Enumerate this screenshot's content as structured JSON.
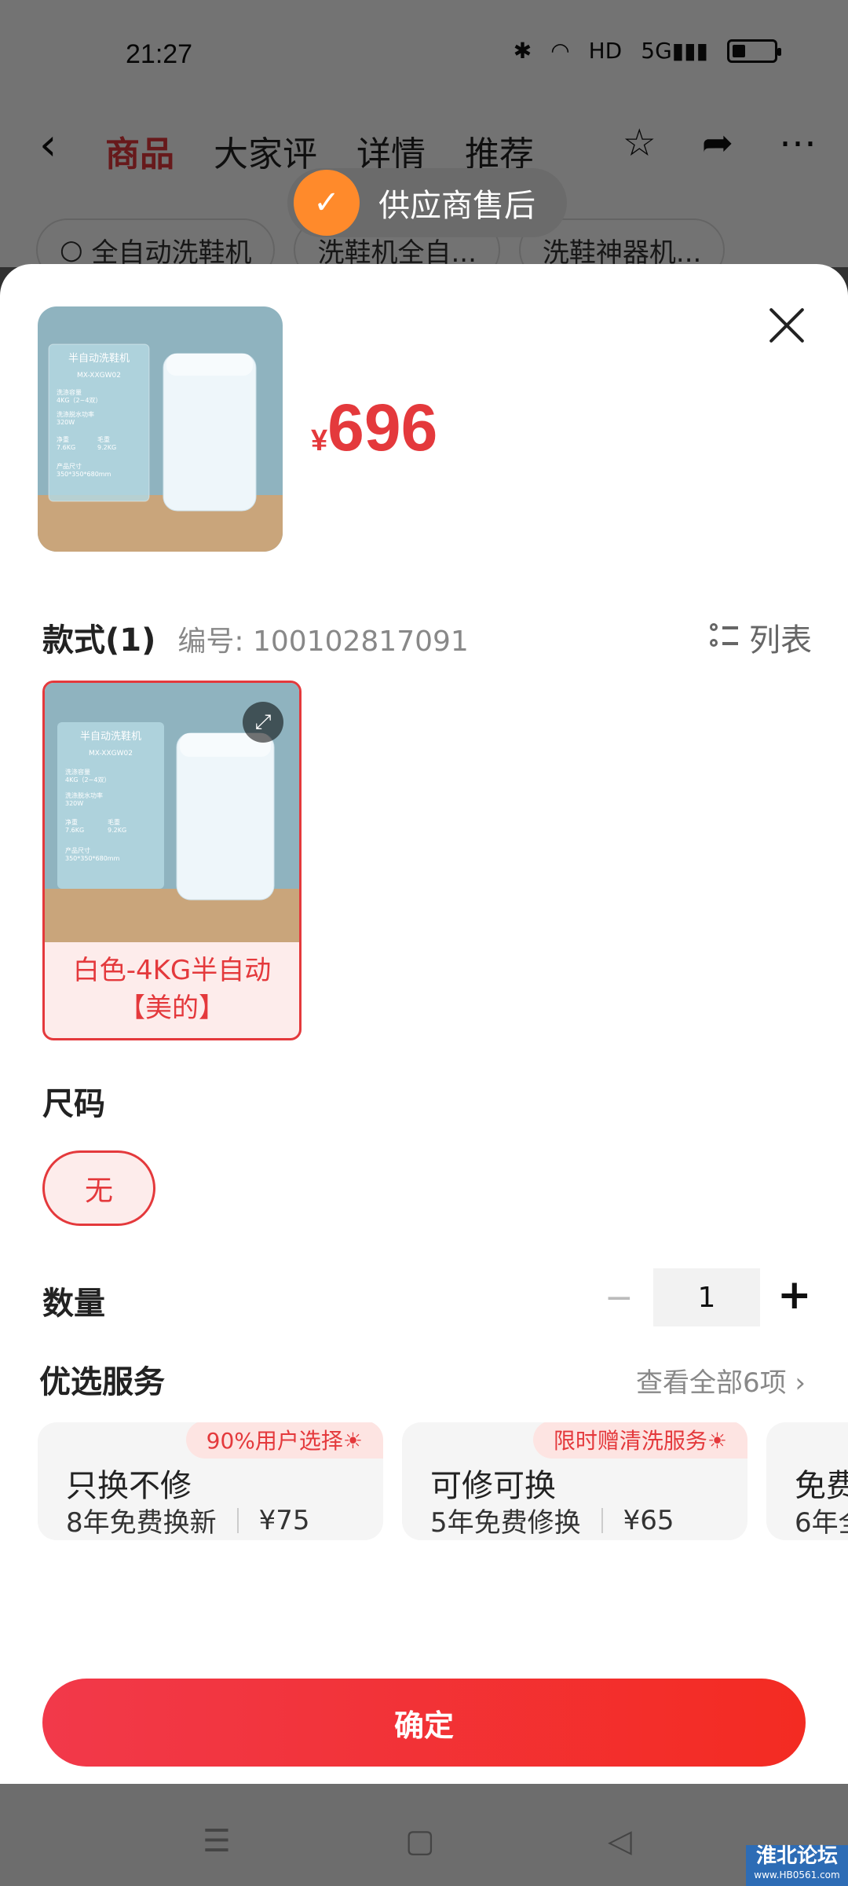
{
  "status_bar": {
    "time": "21:27",
    "bluetooth": "bluetooth-icon",
    "wifi": "wifi-icon",
    "hd": "HD",
    "network": "5G"
  },
  "nav": {
    "back_icon": "chevron-left-icon",
    "tabs": [
      "商品",
      "大家评",
      "详情",
      "推荐"
    ],
    "active_tab": "商品",
    "favorite_icon": "star-icon",
    "share_icon": "share-icon",
    "more_icon": "more-icon"
  },
  "toast": {
    "text": "供应商售后"
  },
  "search_chips": [
    "全自动洗鞋机",
    "洗鞋机全自...",
    "洗鞋神器机..."
  ],
  "sheet": {
    "price_currency": "¥",
    "price": "696",
    "style_title": "款式(1)",
    "sku_code": "编号: 100102817091",
    "list_toggle": "列表",
    "variant": {
      "label_line1": "白色-4KG半自动",
      "label_line2": "【美的】"
    },
    "size_title": "尺码",
    "size_option": "无",
    "qty_title": "数量",
    "qty_minus": "−",
    "qty_value": "1",
    "qty_plus": "+",
    "services_title": "优选服务",
    "services_all": "查看全部6项 ›",
    "services": [
      {
        "tag": "90%用户选择☀",
        "name": "只换不修",
        "desc": "8年免费换新",
        "price": "¥75"
      },
      {
        "tag": "限时赠清洗服务☀",
        "name": "可修可换",
        "desc": "5年免费修换",
        "price": "¥65"
      },
      {
        "tag": "",
        "name": "免费",
        "desc": "6年全",
        "price": ""
      }
    ],
    "confirm": "确定"
  },
  "product_image_text": {
    "title": "半自动洗鞋机",
    "model": "MX-XXGW02",
    "spec1_label": "洗涤容量",
    "spec1_value": "4KG（2~4双）",
    "spec2_label": "洗涤脱水功率",
    "spec2_value": "320W",
    "spec3_label": "净重",
    "spec3_value": "7.6KG",
    "spec4_label": "毛重",
    "spec4_value": "9.2KG",
    "spec5_label": "产品尺寸",
    "spec5_value": "350*350*680mm"
  },
  "watermark": {
    "line1": "淮北论坛",
    "line2": "www.HB0561.com"
  }
}
